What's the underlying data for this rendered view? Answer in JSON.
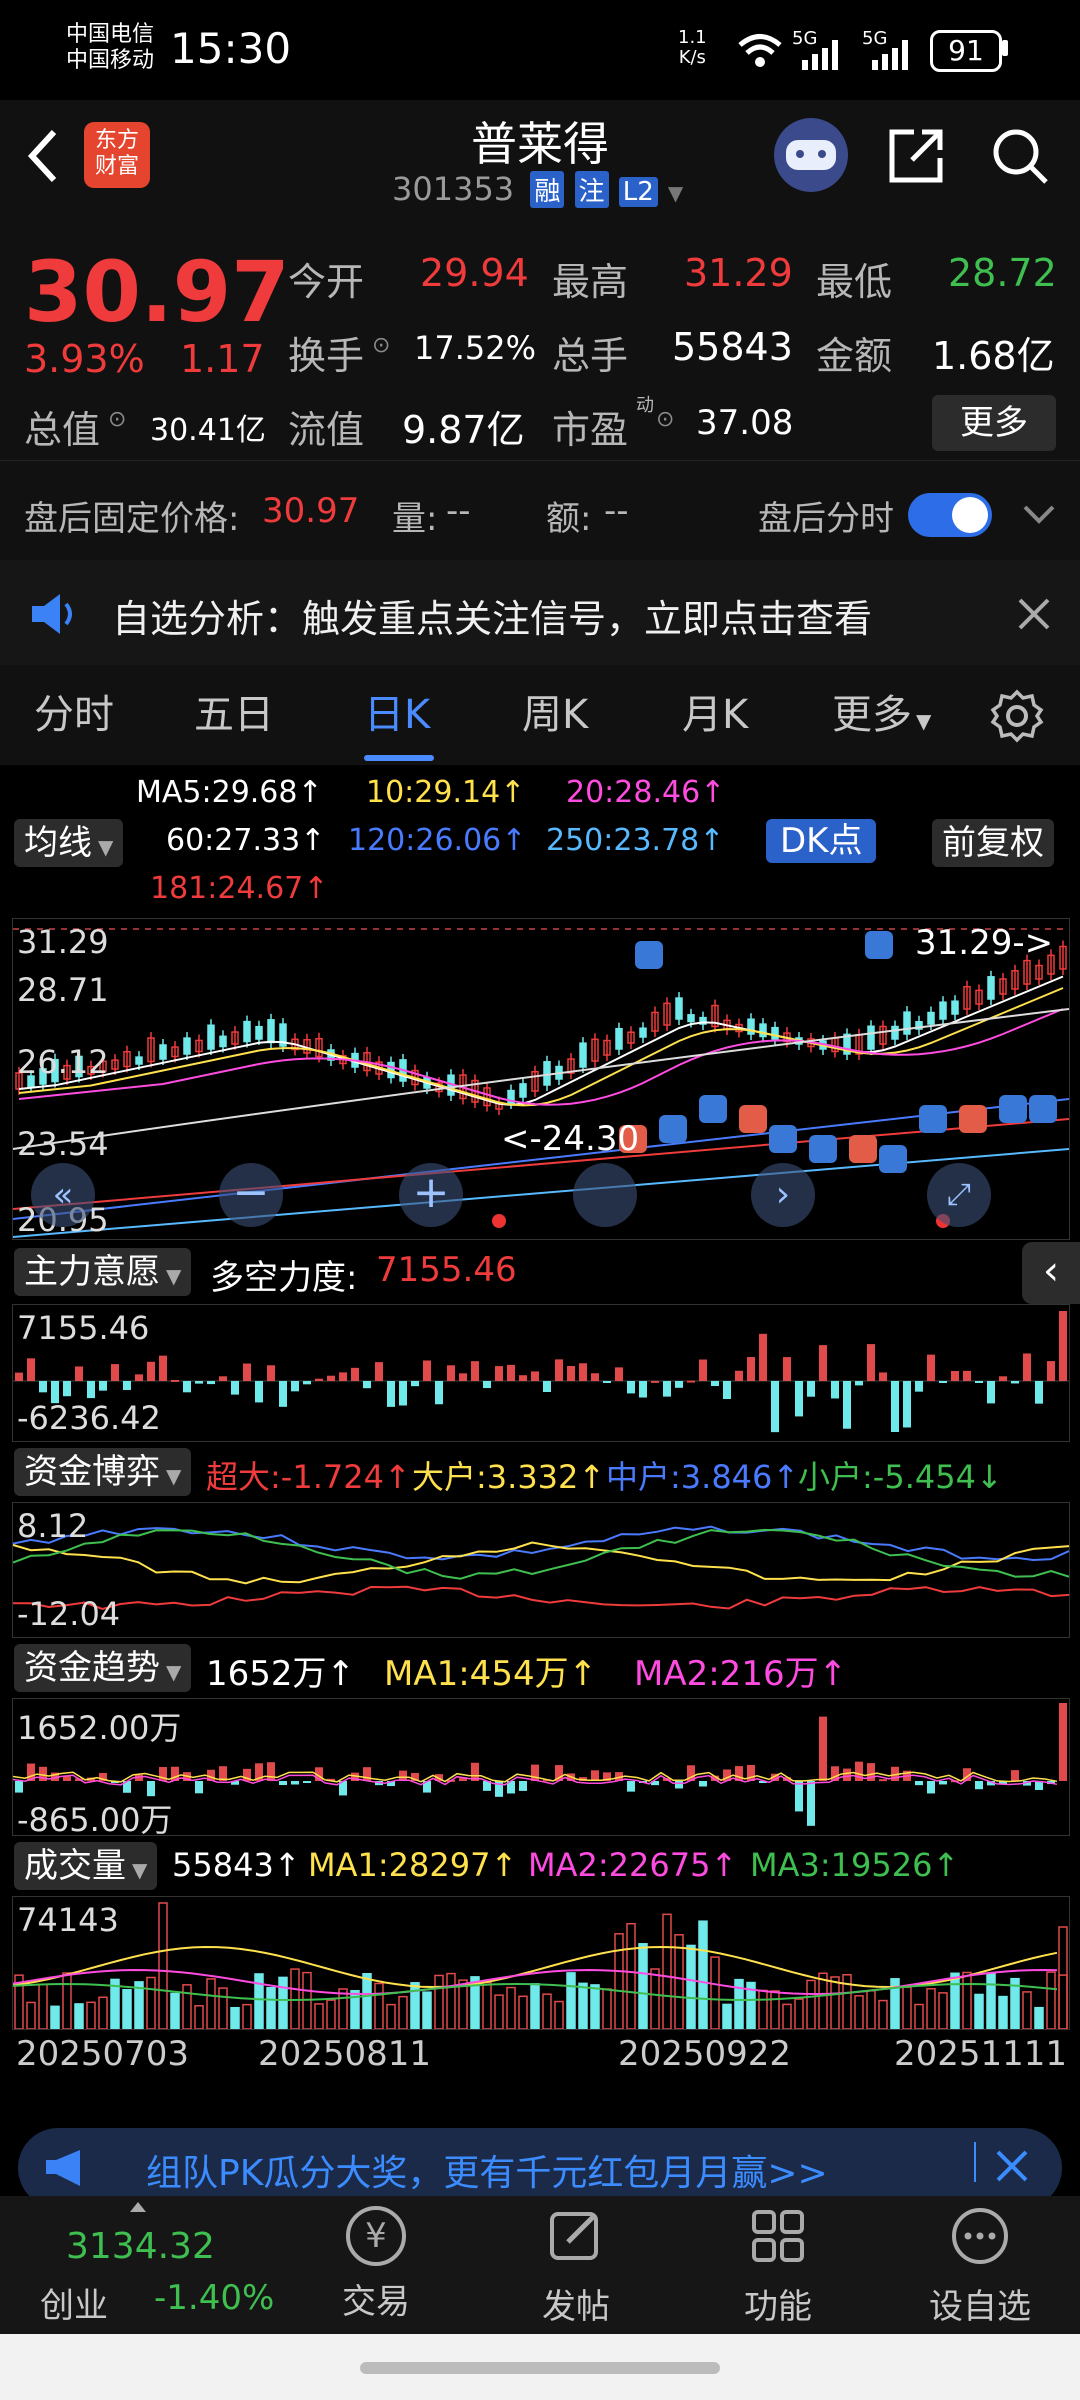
{
  "status_bar": {
    "carrier1": "中国电信",
    "carrier2": "中国移动",
    "time": "15:30",
    "speed_top": "1.1",
    "speed_unit": "K/s",
    "net1": "5G",
    "net2": "5G",
    "battery": "91"
  },
  "header": {
    "logo_top": "东方",
    "logo_bottom": "财富",
    "stock_name": "普莱得",
    "stock_code": "301353",
    "badges": [
      "融",
      "注",
      "L2"
    ]
  },
  "quote": {
    "price": "30.97",
    "change_pct": "3.93%",
    "change_amt": "1.17",
    "open_label": "今开",
    "open": "29.94",
    "high_label": "最高",
    "high": "31.29",
    "low_label": "最低",
    "low": "28.72",
    "turnover_label": "换手",
    "turnover": "17.52%",
    "volume_label": "总手",
    "volume": "55843",
    "amount_label": "金额",
    "amount": "1.68亿",
    "mktcap_label": "总值",
    "mktcap": "30.41亿",
    "float_label": "流值",
    "float": "9.87亿",
    "pe_label": "市盈",
    "pe_sup": "动",
    "pe": "37.08",
    "more_button": "更多"
  },
  "after_hours": {
    "price_label": "盘后固定价格:",
    "price": "30.97",
    "vol_label": "量:",
    "vol": "--",
    "amt_label": "额:",
    "amt": "--",
    "toggle_label": "盘后分时",
    "toggle_on": true
  },
  "notice": {
    "text": "自选分析：触发重点关注信号，立即点击查看"
  },
  "tabs": [
    "分时",
    "五日",
    "日K",
    "周K",
    "月K",
    "更多"
  ],
  "active_tab": 2,
  "ma_legend": {
    "ma5": "MA5:29.68↑",
    "ma10": "10:29.14↑",
    "ma20": "20:28.46↑",
    "ma60": "60:27.33↑",
    "ma120": "120:26.06↑",
    "ma250": "250:23.78↑",
    "ma181": "181:24.67↑",
    "selector": "均线",
    "dk_button": "DK点",
    "fq_button": "前复权"
  },
  "kline": {
    "y_labels": [
      "31.29",
      "28.71",
      "26.12",
      "23.54",
      "20.95"
    ],
    "high_marker": "31.29->",
    "low_marker": "<-24.30",
    "colors": {
      "up": "#ef3b3b",
      "down": "#70e9ea",
      "ma5": "#ffffff",
      "ma10": "#ffe14d",
      "ma20": "#ff4ce0",
      "ma60": "#dddddd",
      "ma120": "#4a7bff",
      "ma250": "#58b9ff",
      "ma181": "#ef3b3b"
    }
  },
  "panel_main_force": {
    "selector": "主力意愿",
    "label": "多空力度:",
    "value": "7155.46",
    "max": "7155.46",
    "min": "-6236.42"
  },
  "panel_capital_game": {
    "selector": "资金博弈",
    "super": "超大:-1.724↑",
    "big": "大户:3.332↑",
    "mid": "中户:3.846↑",
    "small": "小户:-5.454↓",
    "max": "8.12",
    "min": "-12.04"
  },
  "panel_capital_trend": {
    "selector": "资金趋势",
    "value": "1652万↑",
    "ma1": "MA1:454万↑",
    "ma2": "MA2:216万↑",
    "max": "1652.00万",
    "min": "-865.00万"
  },
  "panel_volume": {
    "selector": "成交量",
    "value": "55843↑",
    "ma1": "MA1:28297↑",
    "ma2": "MA2:22675↑",
    "ma3": "MA3:19526↑",
    "max": "74143",
    "dates": [
      "20250703",
      "20250811",
      "20250922",
      "20251111"
    ]
  },
  "banner": {
    "text": "组队PK瓜分大奖，更有千元红包月月赢>>"
  },
  "bottom_nav": {
    "index_value": "3134.32",
    "index_name": "创业",
    "index_change": "-1.40%",
    "items": [
      "交易",
      "发帖",
      "功能",
      "设自选"
    ]
  }
}
